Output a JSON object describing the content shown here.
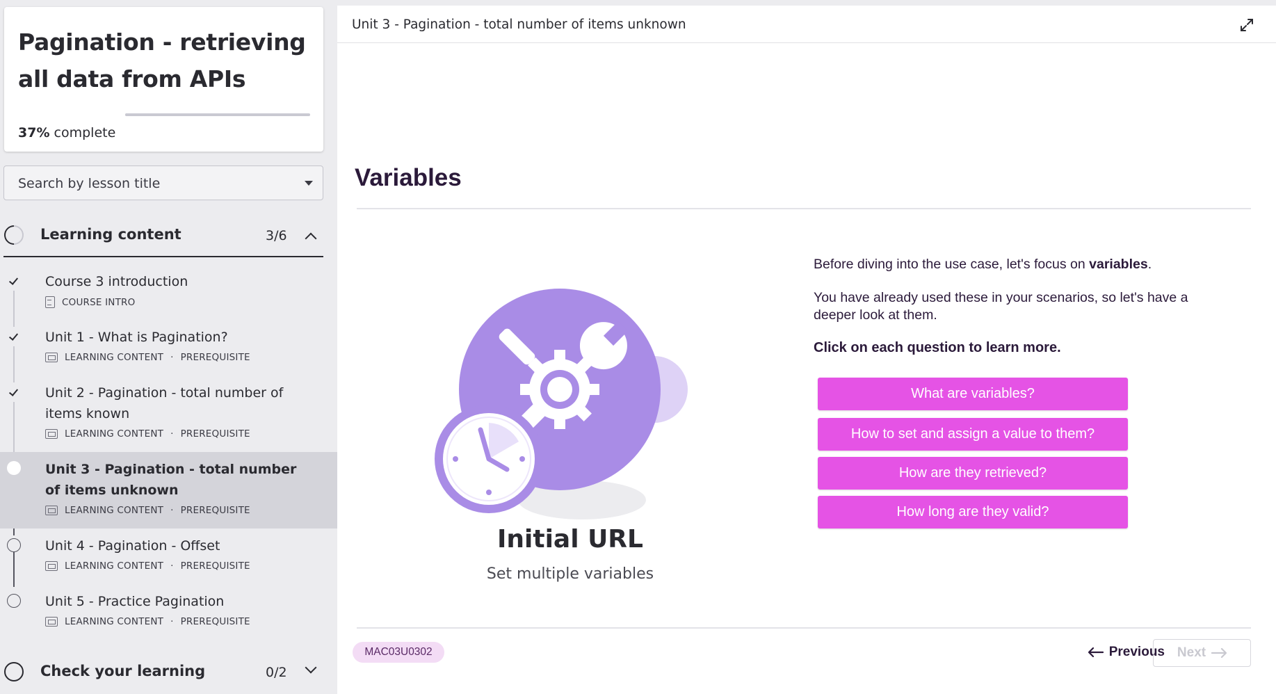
{
  "course": {
    "title": "Pagination - retrieving all data from APIs",
    "progress_percent": 37,
    "progress_value": "37%",
    "progress_suffix": "complete"
  },
  "search": {
    "placeholder": "Search by lesson title"
  },
  "sections": [
    {
      "label": "Learning content",
      "count": "3/6",
      "expanded": true
    },
    {
      "label": "Check your learning",
      "count": "0/2",
      "expanded": false
    }
  ],
  "lessons": [
    {
      "title": "Course 3 introduction",
      "type": "COURSE INTRO",
      "tag": "",
      "status": "done"
    },
    {
      "title": "Unit 1 - What is Pagination?",
      "type": "LEARNING CONTENT",
      "tag": "PREREQUISITE",
      "status": "done"
    },
    {
      "title": "Unit 2 - Pagination - total number of items known",
      "type": "LEARNING CONTENT",
      "tag": "PREREQUISITE",
      "status": "done"
    },
    {
      "title": "Unit 3 - Pagination - total number of items unknown",
      "type": "LEARNING CONTENT",
      "tag": "PREREQUISITE",
      "status": "current"
    },
    {
      "title": "Unit 4 - Pagination - Offset",
      "type": "LEARNING CONTENT",
      "tag": "PREREQUISITE",
      "status": "open"
    },
    {
      "title": "Unit 5 - Practice Pagination",
      "type": "LEARNING CONTENT",
      "tag": "PREREQUISITE",
      "status": "open"
    }
  ],
  "meta_separator": "·",
  "main": {
    "header_title": "Unit 3 - Pagination - total number of items unknown",
    "heading": "Variables",
    "illustration": {
      "title": "Initial URL",
      "subtitle": "Set multiple variables",
      "icon": "tools-clock-icon"
    },
    "intro_prefix": "Before diving into the use case, let's focus on ",
    "intro_bold": "variables",
    "intro_suffix": ".",
    "paragraph2": "You have already used these in your scenarios, so let's have a deeper look at them.",
    "cta": "Click on each question to learn more.",
    "questions": [
      "What are variables?",
      "How to set and assign a value to them?",
      "How are they retrieved?",
      "How long are they valid?"
    ],
    "code": "MAC03U0302",
    "previous_label": "Previous",
    "next_label": "Next"
  },
  "colors": {
    "accent": "#e553e5",
    "illustration_purple": "#a98ce6",
    "heading": "#2b1a3a",
    "badge_bg": "#f3dcf5"
  }
}
